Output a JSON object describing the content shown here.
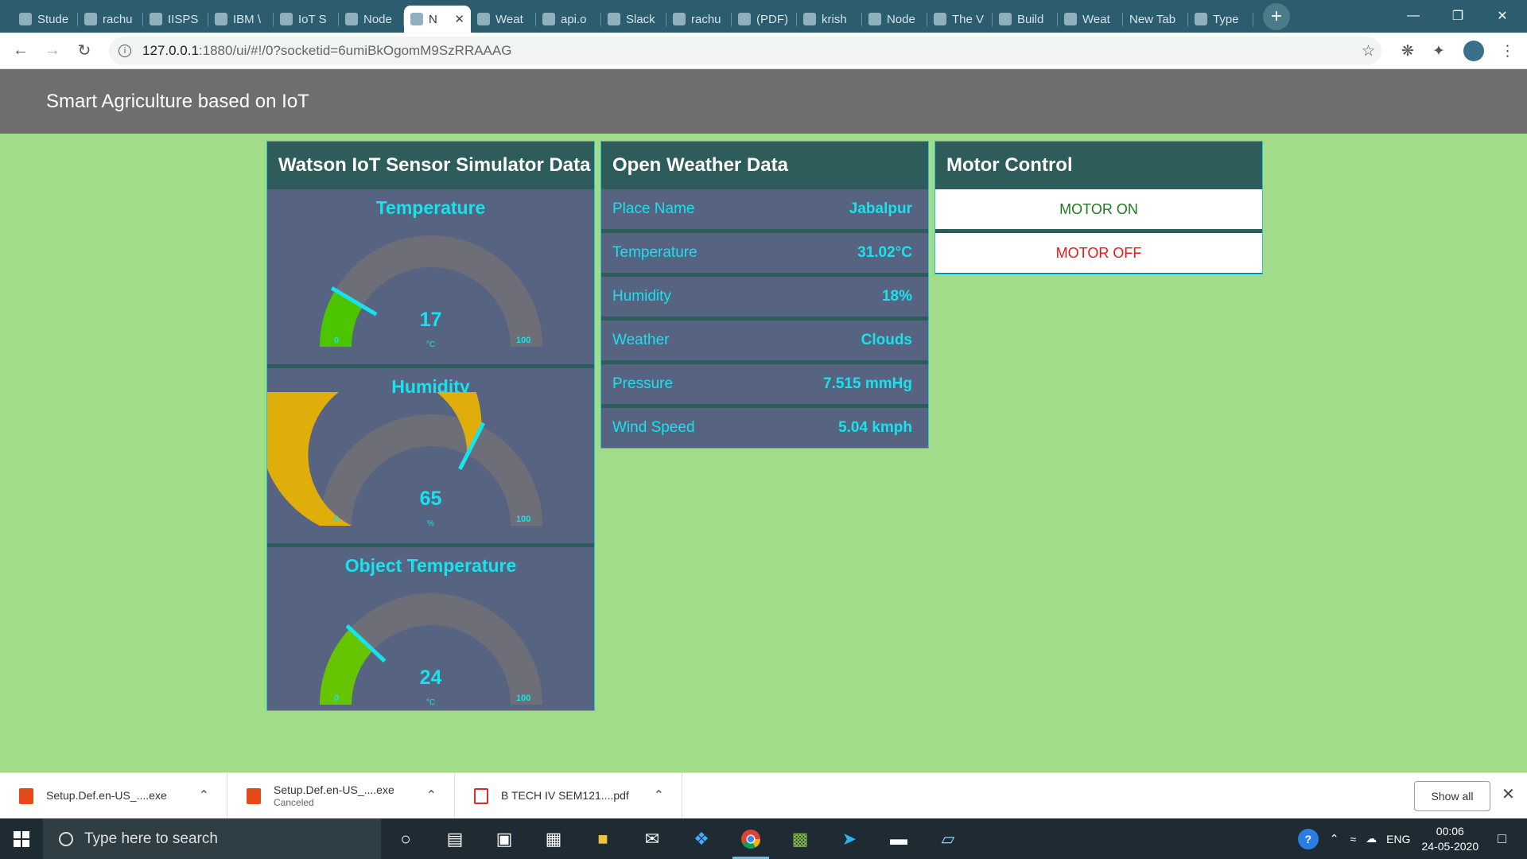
{
  "browser": {
    "tabs": [
      {
        "label": "Stude",
        "icon": "globe-icon"
      },
      {
        "label": "rachu",
        "icon": "github-icon"
      },
      {
        "label": "IISPS",
        "icon": "page-icon"
      },
      {
        "label": "IBM \\",
        "icon": "nodered-icon"
      },
      {
        "label": "IoT S",
        "icon": "ibm-icon"
      },
      {
        "label": "Node",
        "icon": "nodered-icon"
      },
      {
        "label": "N",
        "icon": "nodered-icon",
        "active": true
      },
      {
        "label": "Weat",
        "icon": "weather-icon"
      },
      {
        "label": "api.o",
        "icon": "globe-icon"
      },
      {
        "label": "Slack",
        "icon": "slack-icon"
      },
      {
        "label": "rachu",
        "icon": "github-icon"
      },
      {
        "label": "(PDF)",
        "icon": "researchgate-icon"
      },
      {
        "label": "krish",
        "icon": "blogger-icon"
      },
      {
        "label": "Node",
        "icon": "youtube-icon"
      },
      {
        "label": "The V",
        "icon": "nodered-icon"
      },
      {
        "label": "Build",
        "icon": "nodered-icon"
      },
      {
        "label": "Weat",
        "icon": "nodered-icon"
      },
      {
        "label": "New Tab",
        "icon": ""
      },
      {
        "label": "Type",
        "icon": "google-icon"
      }
    ],
    "url_host": "127.0.0.1",
    "url_path": ":1880/ui/#!/0?socketid=6umiBkOgomM9SzRRAAAG"
  },
  "dashboard": {
    "title": "Smart Agriculture based on IoT",
    "sensor_group": {
      "title": "Watson IoT Sensor Simulator Data",
      "gauges": [
        {
          "label": "Temperature",
          "value": 17,
          "unit": "°C",
          "min": 0,
          "max": 100,
          "color": "#4dc400"
        },
        {
          "label": "Humidity",
          "value": 65,
          "unit": "%",
          "min": 0,
          "max": 100,
          "color": "#e0ae0a"
        },
        {
          "label": "Object Temperature",
          "value": 24,
          "unit": "°C",
          "min": 0,
          "max": 100,
          "color": "#66c400"
        }
      ]
    },
    "weather_group": {
      "title": "Open Weather Data",
      "rows": [
        {
          "label": "Place Name",
          "value": "Jabalpur"
        },
        {
          "label": "Temperature",
          "value": "31.02°C"
        },
        {
          "label": "Humidity",
          "value": "18%"
        },
        {
          "label": "Weather",
          "value": "Clouds"
        },
        {
          "label": "Pressure",
          "value": "7.515 mmHg"
        },
        {
          "label": "Wind Speed",
          "value": "5.04 kmph"
        }
      ]
    },
    "motor_group": {
      "title": "Motor Control",
      "on_label": "MOTOR ON",
      "off_label": "MOTOR OFF"
    }
  },
  "downloads": {
    "items": [
      {
        "name": "Setup.Def.en-US_....exe",
        "status": ""
      },
      {
        "name": "Setup.Def.en-US_....exe",
        "status": "Canceled"
      },
      {
        "name": "B TECH IV SEM121....pdf",
        "status": ""
      }
    ],
    "show_all": "Show all"
  },
  "taskbar": {
    "search_placeholder": "Type here to search",
    "language": "ENG",
    "time": "00:06",
    "date": "24-05-2020"
  },
  "colors": {
    "page_bg": "#a0dc8a",
    "group_bg": "#566482",
    "group_title_bg": "#2e5c5a",
    "accent_text": "#18e2ec",
    "header_bg": "#6e6e6e"
  }
}
